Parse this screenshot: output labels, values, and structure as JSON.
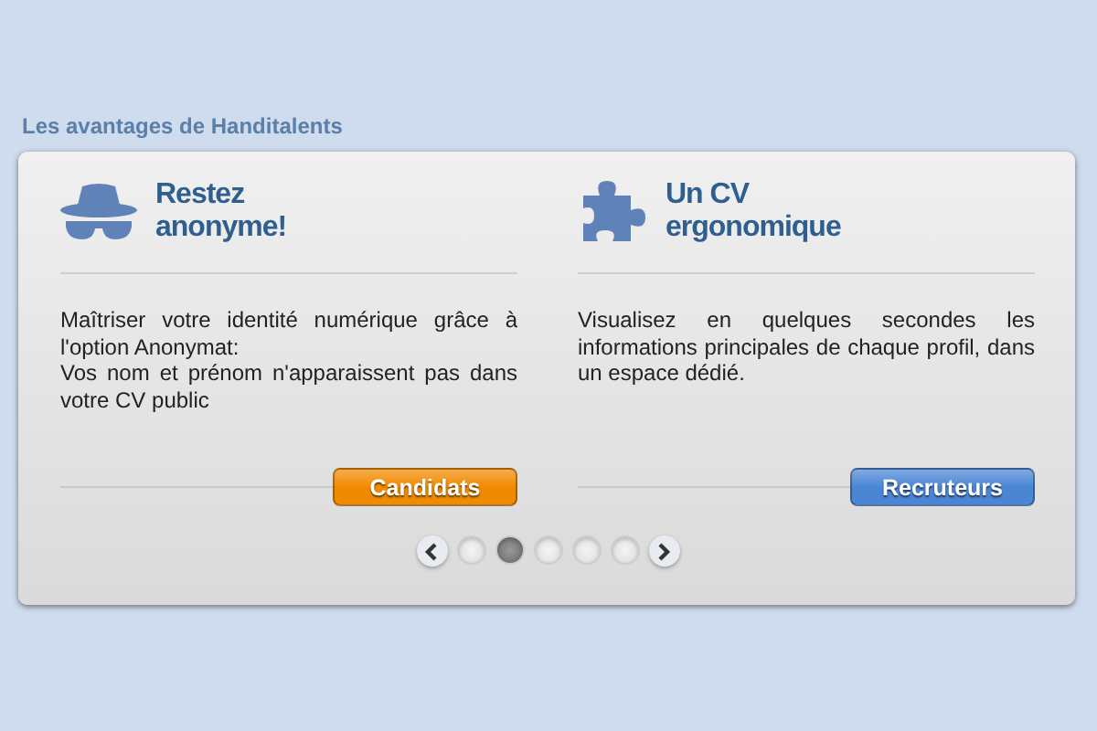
{
  "heading": "Les avantages de Handitalents",
  "columns": [
    {
      "kind": "spy",
      "title_lines": [
        "Restez",
        "anonyme!"
      ],
      "paragraphs": [
        "Maîtriser votre identité numérique grâce à l'option Anonymat:",
        "Vos nom et prénom n'apparaissent pas dans votre CV public"
      ],
      "button": {
        "label": "Candidats",
        "color": "#f08a00"
      }
    },
    {
      "kind": "puzzle",
      "title_lines": [
        "Un CV",
        "ergonomique"
      ],
      "paragraphs": [
        "Visualisez en quelques secondes les informations principales de chaque profil, dans un espace dédié."
      ],
      "button": {
        "label": "Recruteurs",
        "color": "#4a86d4"
      }
    }
  ],
  "pager": {
    "dots": [
      {
        "selected": false
      },
      {
        "selected": true
      },
      {
        "selected": false
      },
      {
        "selected": false
      },
      {
        "selected": false
      }
    ]
  }
}
